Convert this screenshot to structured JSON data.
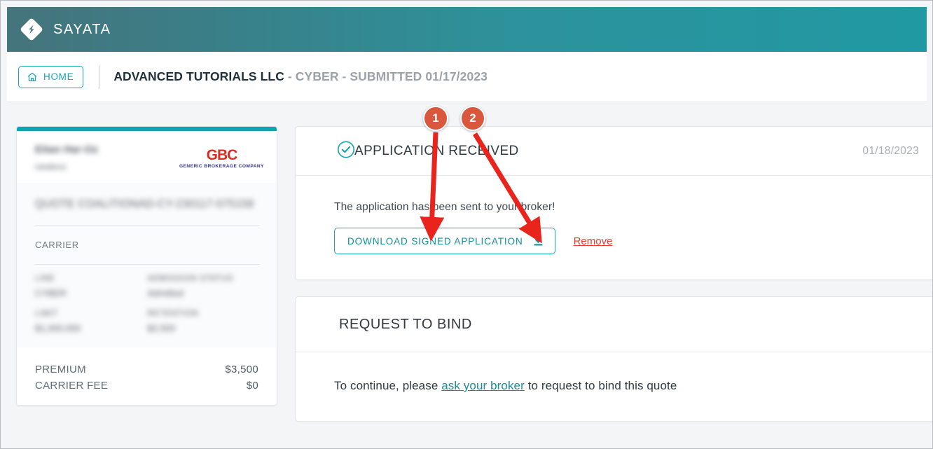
{
  "header": {
    "brand_name": "SAYATA",
    "logo_icon": "sayata-diamond-logo"
  },
  "breadcrumb": {
    "home_label": "HOME",
    "home_icon": "home-icon",
    "company": "ADVANCED TUTORIALS LLC",
    "line_part": " - CYBER - SUBMITTED 01/17/2023"
  },
  "sidebar": {
    "broker_name": "Eitan Har-Oz",
    "broker_sub": "newbroc",
    "brokerage_logo": {
      "mark": "GBC",
      "subtitle": "GENERIC BROKERAGE COMPANY"
    },
    "quote_id": "QUOTE COALITIONAD-CY-230117-075158",
    "carrier_label": "CARRIER",
    "fields": [
      {
        "label": "LINE",
        "value": "CYBER"
      },
      {
        "label": "ADMISSION STATUS",
        "value": "Admitted"
      },
      {
        "label": "LIMIT",
        "value": "$1,000,000"
      },
      {
        "label": "RETENTION",
        "value": "$2,500"
      }
    ],
    "money": [
      {
        "label": "PREMIUM",
        "value": "$3,500"
      },
      {
        "label": "CARRIER FEE",
        "value": "$0"
      }
    ]
  },
  "application_panel": {
    "status_icon": "check-circle-icon",
    "title": "APPLICATION RECEIVED",
    "date": "01/18/2023",
    "message": "The application has been sent to your broker!",
    "download_label": "DOWNLOAD SIGNED APPLICATION",
    "download_icon": "download-icon",
    "remove_label": "Remove"
  },
  "bind_panel": {
    "title": "REQUEST TO BIND",
    "message_before": "To continue, please ",
    "link_text": "ask your broker",
    "message_after": " to request to bind this quote"
  },
  "annotations": {
    "badges": [
      {
        "number": "1",
        "target": "download-signed-application-button"
      },
      {
        "number": "2",
        "target": "remove-link"
      }
    ],
    "arrow_color": "#e8241c",
    "badge_color": "#d9573d"
  }
}
